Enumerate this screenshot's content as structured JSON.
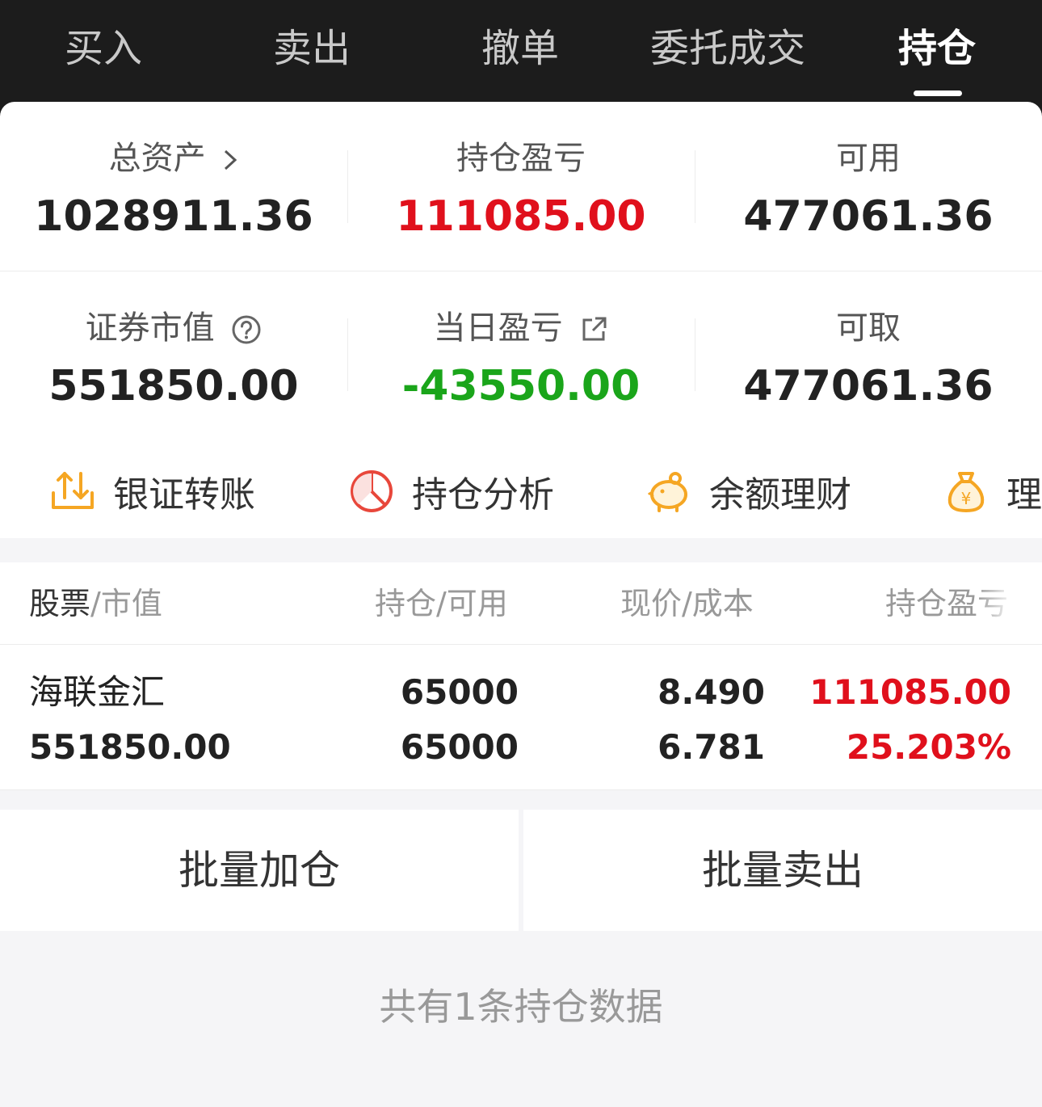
{
  "tabs": [
    {
      "label": "买入"
    },
    {
      "label": "卖出"
    },
    {
      "label": "撤单"
    },
    {
      "label": "委托成交"
    },
    {
      "label": "持仓",
      "active": true
    }
  ],
  "summary": {
    "total_assets": {
      "label": "总资产",
      "value": "1028911.36"
    },
    "position_pnl": {
      "label": "持仓盈亏",
      "value": "111085.00"
    },
    "available": {
      "label": "可用",
      "value": "477061.36"
    },
    "market_value": {
      "label": "证券市值",
      "value": "551850.00"
    },
    "daily_pnl": {
      "label": "当日盈亏",
      "value": "-43550.00"
    },
    "withdrawable": {
      "label": "可取",
      "value": "477061.36"
    }
  },
  "colors": {
    "gain": "#e0101c",
    "loss": "#1aa51a",
    "accent_orange": "#f5a623"
  },
  "actions": [
    {
      "label": "银证转账",
      "icon": "transfer-icon"
    },
    {
      "label": "持仓分析",
      "icon": "pie-chart-icon"
    },
    {
      "label": "余额理财",
      "icon": "piggy-bank-icon"
    },
    {
      "label": "理财",
      "icon": "money-bag-icon"
    }
  ],
  "table": {
    "headers": {
      "col1_main": "股票",
      "col1_sub": "/市值",
      "col2": "持仓/可用",
      "col3": "现价/成本",
      "col4": "持仓盈亏"
    },
    "rows": [
      {
        "name": "海联金汇",
        "market_value": "551850.00",
        "position": "65000",
        "available": "65000",
        "price": "8.490",
        "cost": "6.781",
        "pnl": "111085.00",
        "pnl_pct": "25.203%"
      }
    ]
  },
  "buttons": {
    "batch_add": "批量加仓",
    "batch_sell": "批量卖出"
  },
  "footer": {
    "count_text": "共有1条持仓数据"
  }
}
